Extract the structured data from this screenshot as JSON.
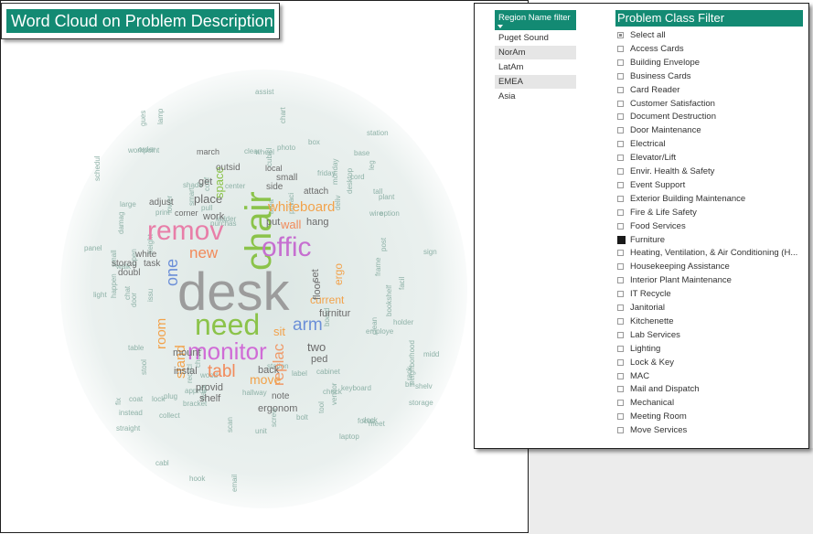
{
  "wordcloud": {
    "title": "Word Cloud on Problem Description",
    "main_words": [
      {
        "text": "desk",
        "color": "#9c9c9c"
      },
      {
        "text": "chair",
        "color": "#8bc34a"
      },
      {
        "text": "remov",
        "color": "#e87ea8"
      },
      {
        "text": "offic",
        "color": "#c66fd0"
      },
      {
        "text": "need",
        "color": "#8bc34a"
      },
      {
        "text": "monitor",
        "color": "#d06bd6"
      },
      {
        "text": "whiteboard",
        "color": "#f2a24a"
      },
      {
        "text": "arm",
        "color": "#6b8fd8"
      },
      {
        "text": "tabl",
        "color": "#f28a5a"
      },
      {
        "text": "replac",
        "color": "#ef9a6a"
      },
      {
        "text": "one",
        "color": "#6b8fd8"
      },
      {
        "text": "new",
        "color": "#f28a5a"
      },
      {
        "text": "room",
        "color": "#f2a24a"
      },
      {
        "text": "stand",
        "color": "#f2a24a"
      },
      {
        "text": "move",
        "color": "#f2a24a"
      },
      {
        "text": "wall",
        "color": "#f28a5a"
      },
      {
        "text": "current",
        "color": "#f2a24a"
      },
      {
        "text": "sit",
        "color": "#f2a24a"
      },
      {
        "text": "place",
        "color": "#6b6b6b"
      },
      {
        "text": "work",
        "color": "#6b6b6b"
      },
      {
        "text": "hang",
        "color": "#6b6b6b"
      },
      {
        "text": "two",
        "color": "#6b6b6b"
      },
      {
        "text": "ergo",
        "color": "#f2a24a"
      },
      {
        "text": "floor",
        "color": "#6b6b6b"
      },
      {
        "text": "furnitur",
        "color": "#6b6b6b"
      },
      {
        "text": "space",
        "color": "#8bc34a"
      },
      {
        "text": "mount",
        "color": "#6b6b6b"
      },
      {
        "text": "instal",
        "color": "#6b6b6b"
      },
      {
        "text": "provid",
        "color": "#6b6b6b"
      },
      {
        "text": "shelf",
        "color": "#6b6b6b"
      },
      {
        "text": "back",
        "color": "#6b6b6b"
      },
      {
        "text": "ergonom",
        "color": "#6b6b6b"
      },
      {
        "text": "get",
        "color": "#6b6b6b"
      },
      {
        "text": "side",
        "color": "#6b6b6b"
      },
      {
        "text": "attach",
        "color": "#6b6b6b"
      },
      {
        "text": "small",
        "color": "#6b6b6b"
      },
      {
        "text": "put",
        "color": "#6b6b6b"
      },
      {
        "text": "ped",
        "color": "#6b6b6b"
      },
      {
        "text": "note",
        "color": "#6b6b6b"
      },
      {
        "text": "doubl",
        "color": "#6b6b6b"
      },
      {
        "text": "storag",
        "color": "#6b6b6b"
      },
      {
        "text": "task",
        "color": "#6b6b6b"
      },
      {
        "text": "white",
        "color": "#6b6b6b"
      },
      {
        "text": "adjust",
        "color": "#6b6b6b"
      },
      {
        "text": "corner",
        "color": "#6b6b6b"
      },
      {
        "text": "set",
        "color": "#6b6b6b"
      },
      {
        "text": "outsid",
        "color": "#6b6b6b"
      },
      {
        "text": "march",
        "color": "#6b6b6b"
      },
      {
        "text": "local",
        "color": "#6b6b6b"
      }
    ],
    "small_words": [
      "happen",
      "unit",
      "bin",
      "chart",
      "ladder",
      "midd",
      "keyboard",
      "bolt",
      "conf",
      "frame",
      "height",
      "cubicl",
      "neighborhood",
      "desktop",
      "print",
      "screw",
      "employe",
      "gues",
      "table",
      "friday",
      "hallway",
      "cabinet",
      "station",
      "base",
      "track",
      "coat",
      "email",
      "collect",
      "storage",
      "cord",
      "meet",
      "laptop",
      "lamp",
      "privaci",
      "panel",
      "vendor",
      "scan",
      "chang",
      "area",
      "facil",
      "door",
      "wheel",
      "cabl",
      "smart",
      "rack",
      "board",
      "holder",
      "lock",
      "open",
      "tall",
      "plant",
      "sign",
      "light",
      "wire",
      "order",
      "shelv",
      "shade",
      "photo",
      "leg",
      "plug",
      "purchas",
      "label",
      "post",
      "pull",
      "hook",
      "fix",
      "bracket",
      "tool",
      "stool",
      "clear",
      "dock",
      "bookshelf",
      "wood",
      "workpoint",
      "straight",
      "station",
      "schedul",
      "recycl",
      "option",
      "center",
      "focus",
      "lower",
      "damag",
      "instead",
      "walk",
      "check",
      "assist",
      "monday",
      "deliv",
      "approv",
      "box",
      "clean",
      "issu",
      "small",
      "large",
      "chat"
    ]
  },
  "region_filter": {
    "title": "Region Name filter",
    "items": [
      {
        "label": "Puget Sound",
        "selected": false
      },
      {
        "label": "NorAm",
        "selected": true
      },
      {
        "label": "LatAm",
        "selected": false
      },
      {
        "label": "EMEA",
        "selected": true
      },
      {
        "label": "Asia",
        "selected": false
      }
    ]
  },
  "class_filter": {
    "title": "Problem Class Filter",
    "items": [
      {
        "label": "Select all",
        "state": "partial"
      },
      {
        "label": "Access Cards",
        "state": "unchecked"
      },
      {
        "label": "Building Envelope",
        "state": "unchecked"
      },
      {
        "label": "Business Cards",
        "state": "unchecked"
      },
      {
        "label": "Card Reader",
        "state": "unchecked"
      },
      {
        "label": "Customer Satisfaction",
        "state": "unchecked"
      },
      {
        "label": "Document Destruction",
        "state": "unchecked"
      },
      {
        "label": "Door Maintenance",
        "state": "unchecked"
      },
      {
        "label": "Electrical",
        "state": "unchecked"
      },
      {
        "label": "Elevator/Lift",
        "state": "unchecked"
      },
      {
        "label": "Envir. Health & Safety",
        "state": "unchecked"
      },
      {
        "label": "Event Support",
        "state": "unchecked"
      },
      {
        "label": "Exterior Building Maintenance",
        "state": "unchecked"
      },
      {
        "label": "Fire & Life Safety",
        "state": "unchecked"
      },
      {
        "label": "Food Services",
        "state": "unchecked"
      },
      {
        "label": "Furniture",
        "state": "checked"
      },
      {
        "label": "Heating, Ventilation, & Air Conditioning (H...",
        "state": "unchecked"
      },
      {
        "label": "Housekeeping Assistance",
        "state": "unchecked"
      },
      {
        "label": "Interior Plant Maintenance",
        "state": "unchecked"
      },
      {
        "label": "IT Recycle",
        "state": "unchecked"
      },
      {
        "label": "Janitorial",
        "state": "unchecked"
      },
      {
        "label": "Kitchenette",
        "state": "unchecked"
      },
      {
        "label": "Lab Services",
        "state": "unchecked"
      },
      {
        "label": "Lighting",
        "state": "unchecked"
      },
      {
        "label": "Lock & Key",
        "state": "unchecked"
      },
      {
        "label": "MAC",
        "state": "unchecked"
      },
      {
        "label": "Mail and Dispatch",
        "state": "unchecked"
      },
      {
        "label": "Mechanical",
        "state": "unchecked"
      },
      {
        "label": "Meeting Room",
        "state": "unchecked"
      },
      {
        "label": "Move Services",
        "state": "unchecked"
      }
    ]
  },
  "colors": {
    "accent": "#138a73"
  }
}
